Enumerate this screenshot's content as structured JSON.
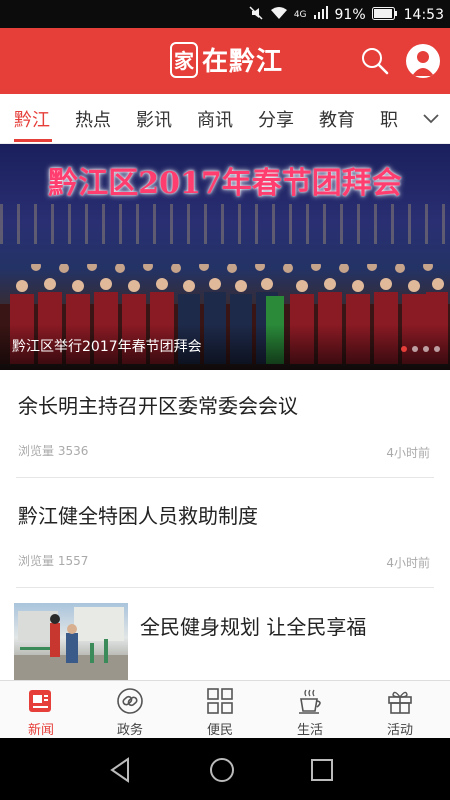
{
  "status_bar": {
    "network": "4G",
    "battery": "91%",
    "time": "14:53"
  },
  "app": {
    "logo_seal": "家",
    "logo_text": "在黔江",
    "brand_color": "#e63f3a"
  },
  "tabs": {
    "items": [
      "黔江",
      "热点",
      "影讯",
      "商讯",
      "分享",
      "教育",
      "职"
    ],
    "active_index": 0
  },
  "banner": {
    "title": "黔江区2017年春节团拜会",
    "caption": "黔江区举行2017年春节团拜会",
    "slide_count": 4,
    "active_slide": 1
  },
  "feed": {
    "items": [
      {
        "title": "余长明主持召开区委常委会会议",
        "views": "浏览量 3536",
        "time": "4小时前"
      },
      {
        "title": "黔江健全特困人员救助制度",
        "views": "浏览量 1557",
        "time": "4小时前"
      },
      {
        "title": "全民健身规划 让全民享福"
      }
    ]
  },
  "bottom_nav": {
    "items": [
      {
        "label": "新闻",
        "icon": "news-icon"
      },
      {
        "label": "政务",
        "icon": "link-icon"
      },
      {
        "label": "便民",
        "icon": "grid-icon"
      },
      {
        "label": "生活",
        "icon": "coffee-icon"
      },
      {
        "label": "活动",
        "icon": "gift-icon"
      }
    ],
    "active_index": 0
  },
  "system_nav": [
    "back-icon",
    "home-icon",
    "recents-icon"
  ]
}
